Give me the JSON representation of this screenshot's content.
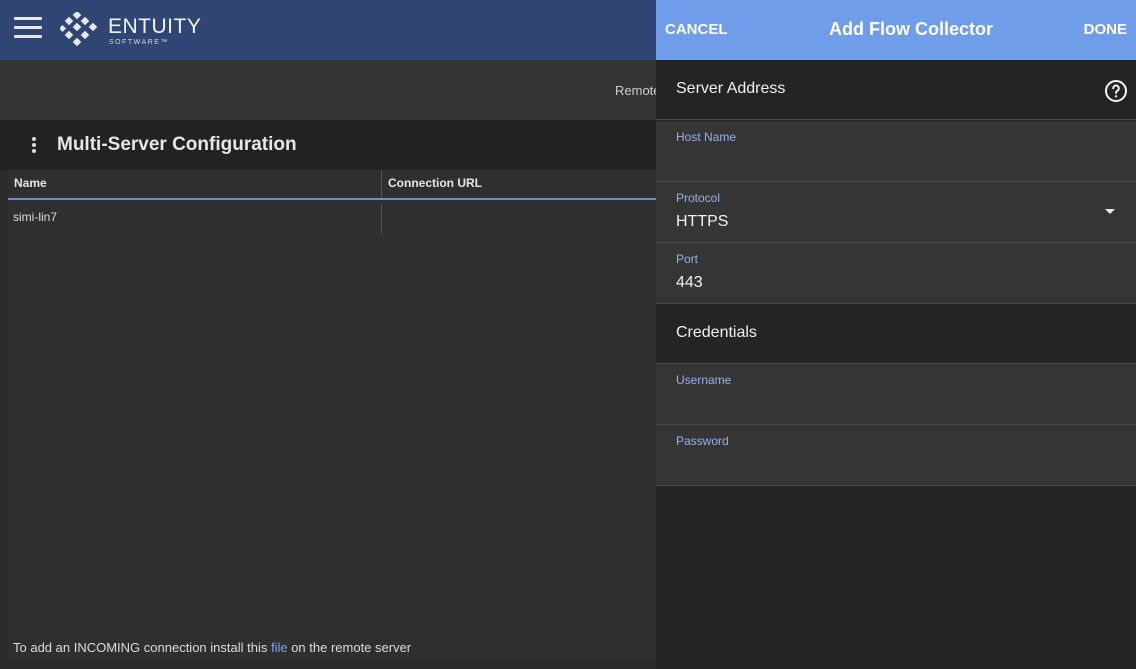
{
  "app": {
    "logo": {
      "name": "ENTUITY",
      "sub": "SOFTWARE™"
    }
  },
  "subbar": {
    "remote_text": "Remote"
  },
  "panel": {
    "title": "Multi-Server Configuration"
  },
  "grid": {
    "columns": [
      "Name",
      "Connection URL"
    ],
    "rows": [
      {
        "name": "simi-lin7",
        "url": ""
      }
    ]
  },
  "footer": {
    "prefix": "To add an INCOMING connection install this ",
    "link": "file",
    "suffix": " on the remote server"
  },
  "drawer": {
    "cancel_label": "CANCEL",
    "title": "Add Flow Collector",
    "done_label": "DONE",
    "sections": {
      "server_address": "Server Address",
      "credentials": "Credentials"
    },
    "fields": {
      "host_name": {
        "label": "Host Name",
        "value": ""
      },
      "protocol": {
        "label": "Protocol",
        "value": "HTTPS"
      },
      "port": {
        "label": "Port",
        "value": "443"
      },
      "username": {
        "label": "Username",
        "value": ""
      },
      "password": {
        "label": "Password",
        "value": ""
      }
    }
  },
  "colors": {
    "topbar": "#2f4674",
    "drawer_bar": "#6f9de9",
    "field_label": "#8fb3f2",
    "link": "#7aa3ea"
  },
  "icons": [
    "hamburger-menu-icon",
    "entuity-logo-icon",
    "kebab-menu-icon",
    "help-circle-icon",
    "dropdown-arrow-icon"
  ]
}
